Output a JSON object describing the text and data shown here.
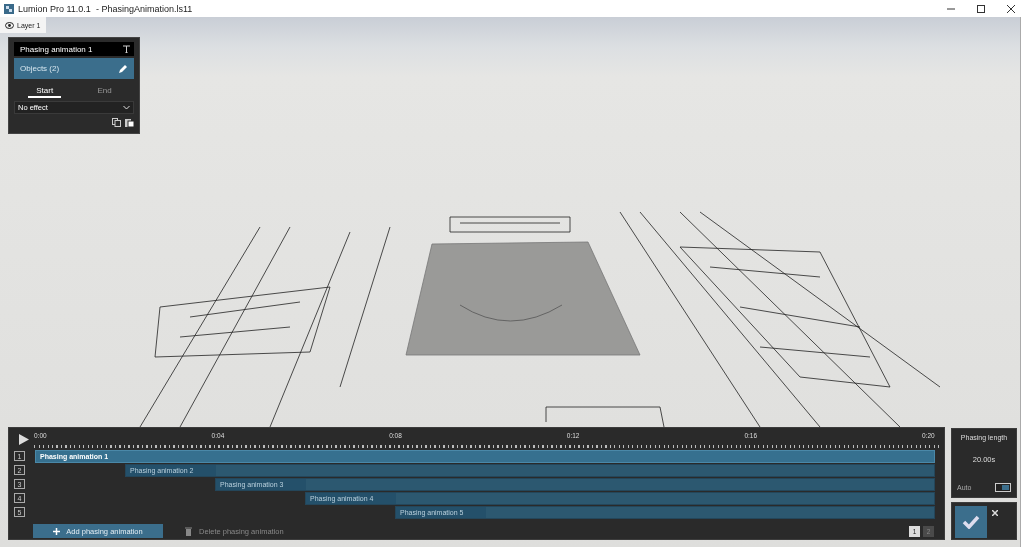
{
  "window": {
    "title": "Lumion Pro 11.0.1  - PhasingAnimation.ls11"
  },
  "layer": {
    "label": "Layer 1",
    "visible": true
  },
  "phase_panel": {
    "name": "Phasing animation 1",
    "objects": "Objects (2)",
    "tabs": [
      {
        "label": "Start",
        "selected": true
      },
      {
        "label": "End",
        "selected": false
      }
    ],
    "effect": "No effect"
  },
  "timeline": {
    "time_labels": [
      "0:00",
      "0:04",
      "0:08",
      "0:12",
      "0:16",
      "0:20"
    ],
    "tracks": [
      {
        "number": "1",
        "label": "Phasing animation 1",
        "selected": true
      },
      {
        "number": "2",
        "label": "Phasing animation 2",
        "selected": false
      },
      {
        "number": "3",
        "label": "Phasing animation 3",
        "selected": false
      },
      {
        "number": "4",
        "label": "Phasing animation 4",
        "selected": false
      },
      {
        "number": "5",
        "label": "Phasing animation 5",
        "selected": false
      }
    ],
    "add_button": "Add phasing animation",
    "delete_button": "Delete phasing animation",
    "pages": [
      {
        "label": "1",
        "selected": true
      },
      {
        "label": "2",
        "selected": false
      }
    ]
  },
  "phasing_length": {
    "label": "Phasing length",
    "value": "20.00s",
    "auto_label": "Auto",
    "auto_on": true
  }
}
